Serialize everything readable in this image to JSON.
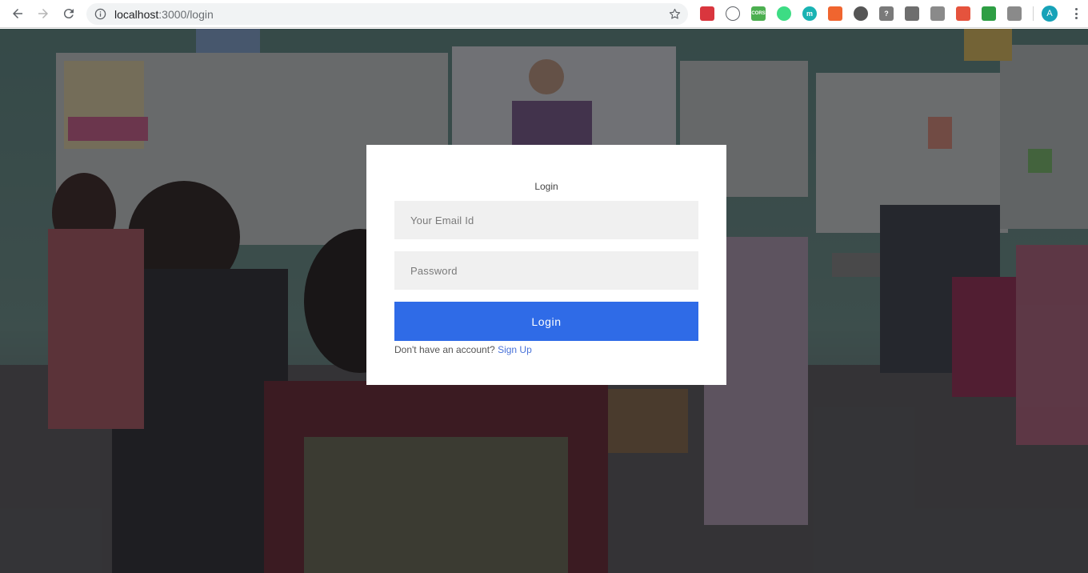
{
  "browser": {
    "url_host": "localhost",
    "url_rest": ":3000/login",
    "avatar_letter": "A",
    "extensions": [
      {
        "icon": "red-square-icon",
        "color": "#d9363e",
        "label": ""
      },
      {
        "icon": "code-brackets-icon",
        "color": "#ffffff",
        "label": ""
      },
      {
        "icon": "cors-icon",
        "color": "#4caf50",
        "label": "CORS"
      },
      {
        "icon": "green-ring-icon",
        "color": "#3ddc84",
        "label": ""
      },
      {
        "icon": "m-icon",
        "color": "#19b3b3",
        "label": "m"
      },
      {
        "icon": "fire-icon",
        "color": "#f0652f",
        "label": ""
      },
      {
        "icon": "moon-icon",
        "color": "#555555",
        "label": ""
      },
      {
        "icon": "shield-question-icon",
        "color": "#7a7a7a",
        "label": "?"
      },
      {
        "icon": "bag-icon",
        "color": "#6e6e6e",
        "label": ""
      },
      {
        "icon": "vue-icon",
        "color": "#8a8a8a",
        "label": ""
      },
      {
        "icon": "red-note-icon",
        "color": "#e5533d",
        "label": ""
      },
      {
        "icon": "green-search-icon",
        "color": "#2e9e44",
        "label": ""
      },
      {
        "icon": "puzzle-icon",
        "color": "#8a8a8a",
        "label": ""
      }
    ]
  },
  "login": {
    "title": "Login",
    "email_placeholder": "Your Email Id",
    "password_placeholder": "Password",
    "button_label": "Login",
    "signup_prompt": "Don't have an account?",
    "signup_link": "Sign Up"
  },
  "colors": {
    "primary": "#2f6be7",
    "link": "#4a73d9",
    "field_bg": "#f0f0f0"
  }
}
